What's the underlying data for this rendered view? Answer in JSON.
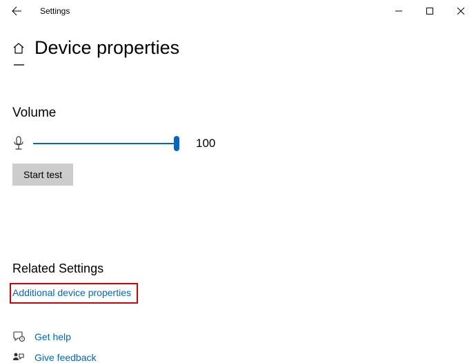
{
  "window": {
    "title": "Settings"
  },
  "page": {
    "title": "Device properties"
  },
  "volume": {
    "label": "Volume",
    "value": "100",
    "test_button": "Start test"
  },
  "related": {
    "heading": "Related Settings",
    "additional_link": "Additional device properties"
  },
  "footer": {
    "get_help": "Get help",
    "give_feedback": "Give feedback"
  }
}
